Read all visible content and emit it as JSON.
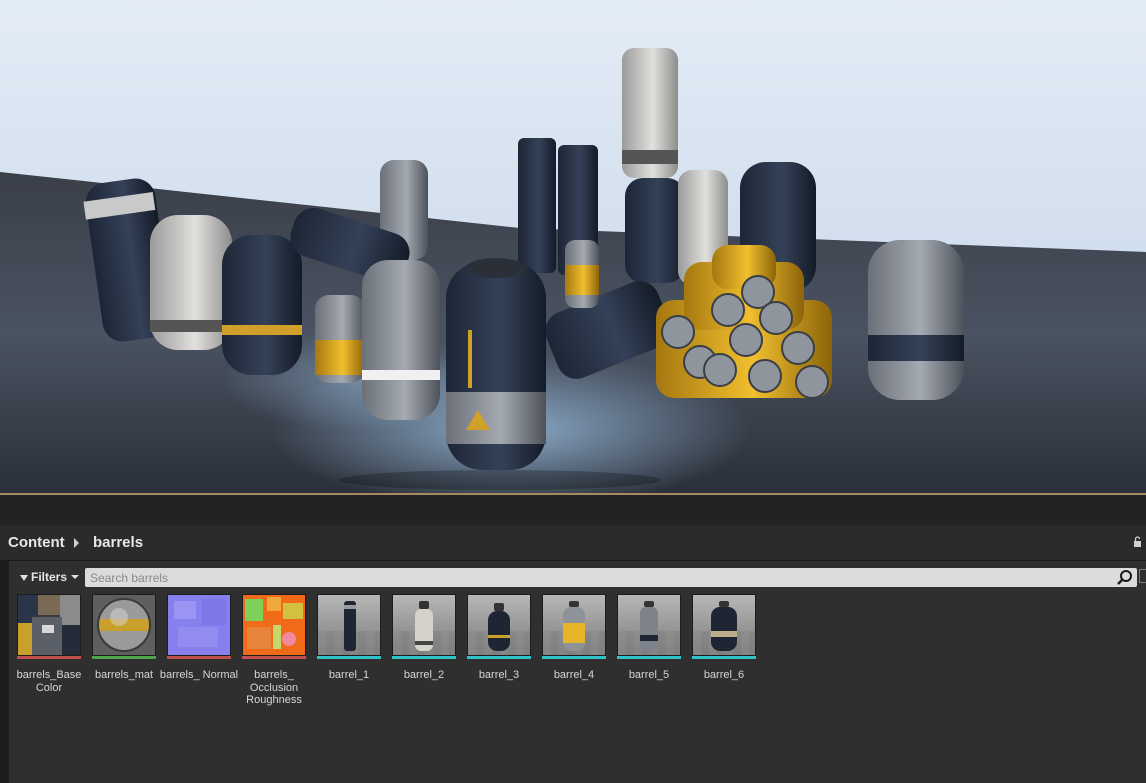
{
  "breadcrumb": {
    "root": "Content",
    "folder": "barrels"
  },
  "toolbar": {
    "filters_label": "Filters",
    "search_placeholder": "Search barrels",
    "search_value": ""
  },
  "assets": [
    {
      "label": "barrels_Base Color",
      "type": "texture",
      "bar_color": "#c0504d"
    },
    {
      "label": "barrels_mat",
      "type": "material",
      "bar_color": "#4fa54b"
    },
    {
      "label": "barrels_ Normal",
      "type": "texture",
      "bar_color": "#c0504d"
    },
    {
      "label": "barrels_ Occlusion Roughness",
      "type": "texture",
      "bar_color": "#c0504d"
    },
    {
      "label": "barrel_1",
      "type": "static-mesh",
      "bar_color": "#2fc2c8"
    },
    {
      "label": "barrel_2",
      "type": "static-mesh",
      "bar_color": "#2fc2c8"
    },
    {
      "label": "barrel_3",
      "type": "static-mesh",
      "bar_color": "#2fc2c8"
    },
    {
      "label": "barrel_4",
      "type": "static-mesh",
      "bar_color": "#2fc2c8"
    },
    {
      "label": "barrel_5",
      "type": "static-mesh",
      "bar_color": "#2fc2c8"
    },
    {
      "label": "barrel_6",
      "type": "static-mesh",
      "bar_color": "#2fc2c8"
    }
  ],
  "icons": {
    "filters": "funnel-icon",
    "search": "magnifier-icon",
    "lock": "lock-icon",
    "breadcrumb_separator": "chevron-right-icon"
  },
  "colors": {
    "accent_texture": "#c0504d",
    "accent_material": "#4fa54b",
    "accent_mesh": "#2fc2c8",
    "panel_bg": "#2f2f2f"
  }
}
